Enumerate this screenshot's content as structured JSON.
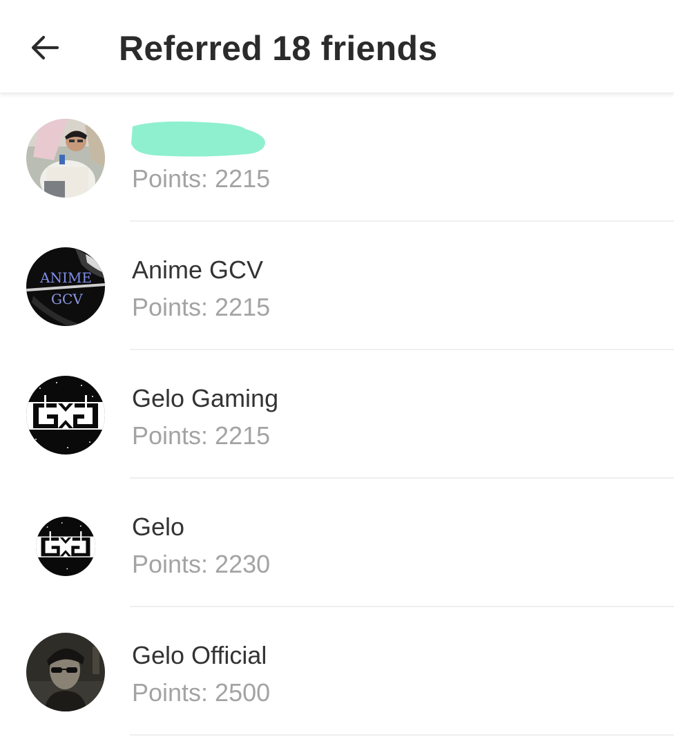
{
  "header": {
    "title": "Referred 18 friends",
    "back_icon": "arrow-left-icon"
  },
  "friends": [
    {
      "name": "",
      "points": "Points: 2215",
      "avatar": "avatar-photo-boy",
      "name_redacted": true
    },
    {
      "name": "Anime GCV",
      "points": "Points: 2215",
      "avatar": "avatar-anime-gcv",
      "avatar_text": [
        "ANIME",
        "GCV"
      ]
    },
    {
      "name": "Gelo Gaming",
      "points": "Points: 2215",
      "avatar": "avatar-gelo-logo"
    },
    {
      "name": "Gelo",
      "points": "Points: 2230",
      "avatar": "avatar-gelo-logo-small"
    },
    {
      "name": "Gelo Official",
      "points": "Points: 2500",
      "avatar": "avatar-photo-sunglasses"
    }
  ],
  "colors": {
    "redaction": "#8ef0cf",
    "title": "#2b2b2b",
    "name": "#333333",
    "points": "#a3a3a3",
    "divider": "#efefef"
  }
}
